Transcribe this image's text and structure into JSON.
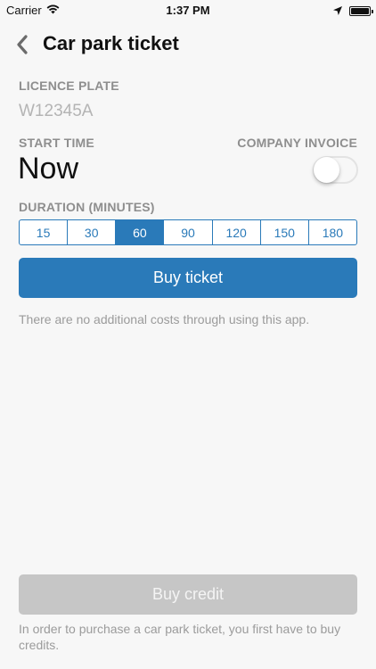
{
  "status_bar": {
    "carrier": "Carrier",
    "time": "1:37 PM",
    "battery_level": 1.0
  },
  "nav": {
    "back_icon": "chevron-left-icon",
    "title": "Car park ticket"
  },
  "licence_plate": {
    "label": "LICENCE PLATE",
    "placeholder": "W12345A",
    "value": ""
  },
  "start_time": {
    "label": "START TIME",
    "value": "Now"
  },
  "company_invoice": {
    "label": "COMPANY INVOICE",
    "enabled": false
  },
  "duration": {
    "label": "DURATION (MINUTES)",
    "options": [
      "15",
      "30",
      "60",
      "90",
      "120",
      "150",
      "180"
    ],
    "selected": "60"
  },
  "buy_ticket": {
    "label": "Buy ticket",
    "note": "There are no additional costs through using this app."
  },
  "buy_credit": {
    "label": "Buy credit",
    "note": "In order to purchase a car park ticket, you first have to buy credits."
  },
  "colors": {
    "accent": "#2a7ab9",
    "disabled_button": "#c6c6c6",
    "label_gray": "#8e8e8e",
    "background": "#f7f7f7"
  }
}
